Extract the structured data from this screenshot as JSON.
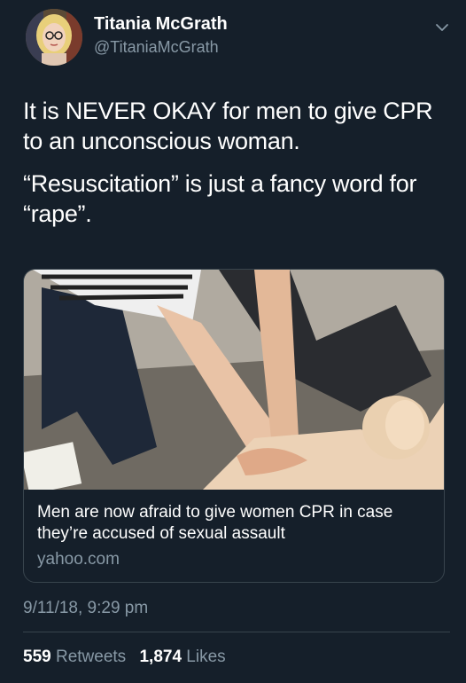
{
  "author": {
    "name": "Titania McGrath",
    "handle": "@TitaniaMcGrath"
  },
  "tweet": {
    "paragraphs": [
      "It is NEVER OKAY for men to give CPR\nto an unconscious woman.",
      "“Resuscitation” is just a fancy word for\n“rape”."
    ]
  },
  "link_card": {
    "title": "Men are now afraid to give women CPR in case they’re accused of sexual assault",
    "domain": "yahoo.com"
  },
  "timestamp": "9/11/18, 9:29 pm",
  "stats": {
    "retweets_count": "559",
    "retweets_label": "Retweets",
    "likes_count": "1,874",
    "likes_label": "Likes"
  },
  "colors": {
    "background": "#151f2a",
    "secondary_text": "#8899a6",
    "border": "#38444d"
  },
  "icons": {
    "menu": "chevron-down-icon"
  }
}
